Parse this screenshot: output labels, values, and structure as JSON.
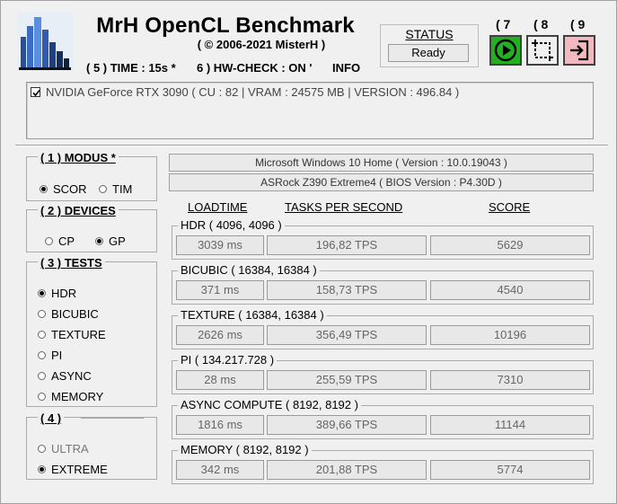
{
  "header": {
    "title": "MrH OpenCL Benchmark",
    "copyright": "( ©  2006-2021 MisterH )",
    "time_option": "( 5 ) TIME : 15s *",
    "hwcheck_option": "6 ) HW-CHECK : ON '",
    "info_option": "INFO"
  },
  "status": {
    "label": "STATUS",
    "value": "Ready"
  },
  "toolbar": {
    "buttons": [
      {
        "num": "( 7",
        "icon": "play-icon",
        "color": "#22b022"
      },
      {
        "num": "( 8",
        "icon": "crop-icon",
        "color": "#f0f0f0"
      },
      {
        "num": "( 9",
        "icon": "exit-icon",
        "color": "#f4b8c0"
      }
    ]
  },
  "gpus": [
    {
      "checked": true,
      "label": "NVIDIA GeForce RTX 3090 ( CU : 82 | VRAM : 24575 MB | VERSION : 496.84 )"
    }
  ],
  "modus": {
    "title": "( 1 ) MODUS *",
    "options": [
      {
        "label": "SCOR",
        "selected": true
      },
      {
        "label": "TIM",
        "selected": false
      }
    ]
  },
  "devices": {
    "title": "( 2 ) DEVICES",
    "options": [
      {
        "label": "CP",
        "selected": false
      },
      {
        "label": "GP",
        "selected": true
      }
    ]
  },
  "tests": {
    "title": "( 3 ) TESTS",
    "options": [
      {
        "label": "HDR",
        "selected": true
      },
      {
        "label": "BICUBIC",
        "selected": false
      },
      {
        "label": "TEXTURE",
        "selected": false
      },
      {
        "label": "PI",
        "selected": false
      },
      {
        "label": "ASYNC",
        "selected": false
      },
      {
        "label": "MEMORY",
        "selected": false
      }
    ]
  },
  "quality": {
    "title": "( 4 )",
    "options": [
      {
        "label": "ULTRA",
        "selected": false
      },
      {
        "label": "EXTREME",
        "selected": true
      }
    ]
  },
  "system": {
    "os": "Microsoft Windows 10 Home ( Version : 10.0.19043 )",
    "board": "ASRock Z390 Extreme4 ( BIOS Version : P4.30D )"
  },
  "columns": {
    "loadtime": "LOADTIME",
    "tps": "TASKS PER SECOND",
    "score": "SCORE"
  },
  "results": [
    {
      "name": "HDR ( 4096, 4096 )",
      "loadtime": "3039 ms",
      "tps": "196,82 TPS",
      "score": "5629"
    },
    {
      "name": "BICUBIC ( 16384, 16384 )",
      "loadtime": "371 ms",
      "tps": "158,73 TPS",
      "score": "4540"
    },
    {
      "name": "TEXTURE ( 16384, 16384 )",
      "loadtime": "2626 ms",
      "tps": "356,49 TPS",
      "score": "10196"
    },
    {
      "name": "PI ( 134.217.728 )",
      "loadtime": "28 ms",
      "tps": "255,59 TPS",
      "score": "7310"
    },
    {
      "name": "ASYNC COMPUTE ( 8192, 8192 )",
      "loadtime": "1816 ms",
      "tps": "389,66 TPS",
      "score": "11144"
    },
    {
      "name": "MEMORY ( 8192, 8192 )",
      "loadtime": "342 ms",
      "tps": "201,88 TPS",
      "score": "5774"
    }
  ]
}
